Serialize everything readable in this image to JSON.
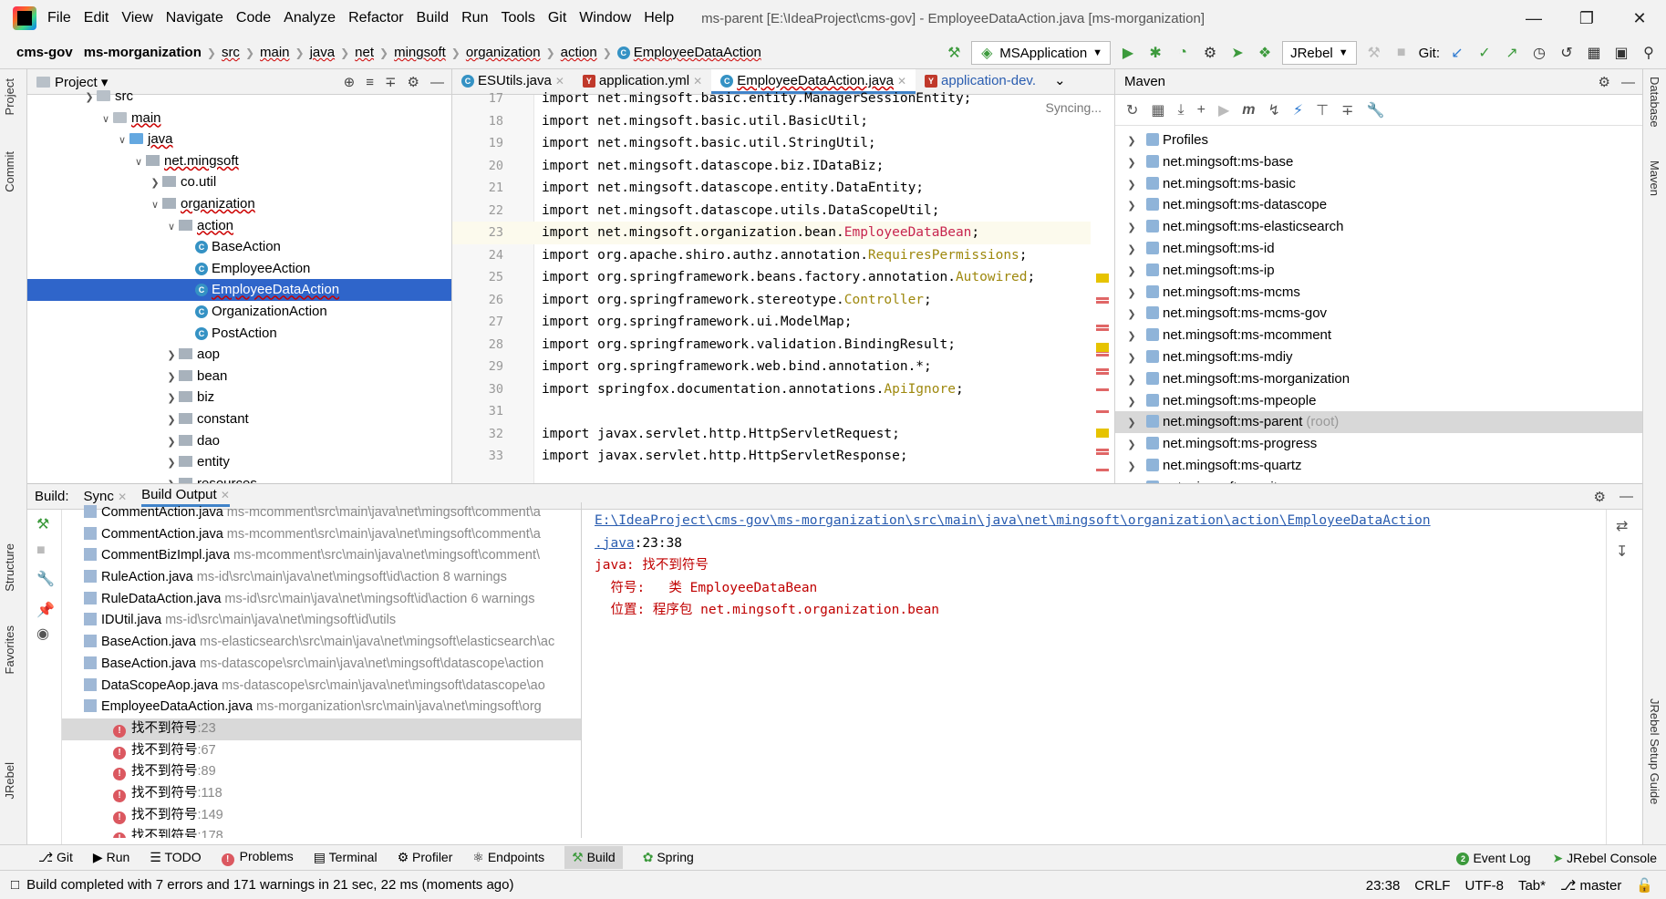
{
  "menu": {
    "items": [
      "File",
      "Edit",
      "View",
      "Navigate",
      "Code",
      "Analyze",
      "Refactor",
      "Build",
      "Run",
      "Tools",
      "Git",
      "Window",
      "Help"
    ],
    "window_title": "ms-parent [E:\\IdeaProject\\cms-gov] - EmployeeDataAction.java [ms-morganization]"
  },
  "breadcrumb": [
    "cms-gov",
    "ms-morganization",
    "src",
    "main",
    "java",
    "net",
    "mingsoft",
    "organization",
    "action",
    "EmployeeDataAction"
  ],
  "run_config": "MSApplication",
  "jrebel_config": "JRebel",
  "git_label": "Git:",
  "project": {
    "title": "Project",
    "tree": [
      {
        "label": "src",
        "indent": 0,
        "type": "folder"
      },
      {
        "label": "main",
        "indent": 1,
        "type": "folder",
        "open": true
      },
      {
        "label": "java",
        "indent": 2,
        "type": "folder-blue",
        "open": true
      },
      {
        "label": "net.mingsoft",
        "indent": 3,
        "type": "pkg",
        "open": true
      },
      {
        "label": "co.util",
        "indent": 4,
        "type": "pkg",
        "open": false
      },
      {
        "label": "organization",
        "indent": 4,
        "type": "pkg",
        "open": true
      },
      {
        "label": "action",
        "indent": 5,
        "type": "pkg",
        "open": true
      },
      {
        "label": "BaseAction",
        "indent": 6,
        "type": "class"
      },
      {
        "label": "EmployeeAction",
        "indent": 6,
        "type": "class"
      },
      {
        "label": "EmployeeDataAction",
        "indent": 6,
        "type": "class",
        "selected": true
      },
      {
        "label": "OrganizationAction",
        "indent": 6,
        "type": "class"
      },
      {
        "label": "PostAction",
        "indent": 6,
        "type": "class"
      },
      {
        "label": "aop",
        "indent": 5,
        "type": "pkg",
        "open": false
      },
      {
        "label": "bean",
        "indent": 5,
        "type": "pkg",
        "open": false
      },
      {
        "label": "biz",
        "indent": 5,
        "type": "pkg",
        "open": false
      },
      {
        "label": "constant",
        "indent": 5,
        "type": "pkg",
        "open": false
      },
      {
        "label": "dao",
        "indent": 5,
        "type": "pkg",
        "open": false
      },
      {
        "label": "entity",
        "indent": 5,
        "type": "pkg",
        "open": false
      },
      {
        "label": "resources",
        "indent": 5,
        "type": "pkg",
        "open": false
      }
    ]
  },
  "editor": {
    "tabs": [
      {
        "label": "ESUtils.java",
        "icon": "class"
      },
      {
        "label": "application.yml",
        "icon": "yml"
      },
      {
        "label": "EmployeeDataAction.java",
        "icon": "class",
        "active": true
      },
      {
        "label": "application-dev.",
        "icon": "yml"
      }
    ],
    "syncing": "Syncing...",
    "lines": [
      {
        "n": "17",
        "pre": "import net.mingsoft.basic.entity.ManagerSessionEntity;"
      },
      {
        "n": "18",
        "pre": "import net.mingsoft.basic.util.BasicUtil;"
      },
      {
        "n": "19",
        "pre": "import net.mingsoft.basic.util.StringUtil;"
      },
      {
        "n": "20",
        "pre": "import net.mingsoft.datascope.biz.IDataBiz;"
      },
      {
        "n": "21",
        "pre": "import net.mingsoft.datascope.entity.DataEntity;"
      },
      {
        "n": "22",
        "pre": "import net.mingsoft.datascope.utils.DataScopeUtil;"
      },
      {
        "n": "23",
        "pre": "import net.mingsoft.organization.bean.",
        "hl": "EmployeeDataBean",
        "post": ";",
        "style": "err",
        "current": true
      },
      {
        "n": "24",
        "pre": "import org.apache.shiro.authz.annotation.",
        "hl": "RequiresPermissions",
        "post": ";",
        "style": "ann"
      },
      {
        "n": "25",
        "pre": "import org.springframework.beans.factory.annotation.",
        "hl": "Autowired",
        "post": ";",
        "style": "ann"
      },
      {
        "n": "26",
        "pre": "import org.springframework.stereotype.",
        "hl": "Controller",
        "post": ";",
        "style": "ann"
      },
      {
        "n": "27",
        "pre": "import org.springframework.ui.ModelMap;"
      },
      {
        "n": "28",
        "pre": "import org.springframework.validation.BindingResult;"
      },
      {
        "n": "29",
        "pre": "import org.springframework.web.bind.annotation.*;"
      },
      {
        "n": "30",
        "pre": "import springfox.documentation.annotations.",
        "hl": "ApiIgnore",
        "post": ";",
        "style": "ann"
      },
      {
        "n": "31",
        "pre": ""
      },
      {
        "n": "32",
        "pre": "import javax.servlet.http.HttpServletRequest;"
      },
      {
        "n": "33",
        "pre": "import javax.servlet.http.HttpServletResponse;"
      }
    ]
  },
  "maven": {
    "title": "Maven",
    "items": [
      {
        "label": "Profiles"
      },
      {
        "label": "net.mingsoft:ms-base"
      },
      {
        "label": "net.mingsoft:ms-basic"
      },
      {
        "label": "net.mingsoft:ms-datascope"
      },
      {
        "label": "net.mingsoft:ms-elasticsearch"
      },
      {
        "label": "net.mingsoft:ms-id"
      },
      {
        "label": "net.mingsoft:ms-ip"
      },
      {
        "label": "net.mingsoft:ms-mcms"
      },
      {
        "label": "net.mingsoft:ms-mcms-gov"
      },
      {
        "label": "net.mingsoft:ms-mcomment"
      },
      {
        "label": "net.mingsoft:ms-mdiy"
      },
      {
        "label": "net.mingsoft:ms-morganization"
      },
      {
        "label": "net.mingsoft:ms-mpeople"
      },
      {
        "label": "net.mingsoft:ms-parent",
        "suffix": "(root)",
        "selected": true
      },
      {
        "label": "net.mingsoft:ms-progress"
      },
      {
        "label": "net.mingsoft:ms-quartz"
      },
      {
        "label": "net.mingsoft:ms-site"
      }
    ]
  },
  "build": {
    "label": "Build:",
    "tabs": [
      "Sync",
      "Build Output"
    ],
    "rows": [
      {
        "file": "CommentAction.java",
        "path": "ms-mcomment\\src\\main\\java\\net\\mingsoft\\comment\\a"
      },
      {
        "file": "CommentAction.java",
        "path": "ms-mcomment\\src\\main\\java\\net\\mingsoft\\comment\\a"
      },
      {
        "file": "CommentBizImpl.java",
        "path": "ms-mcomment\\src\\main\\java\\net\\mingsoft\\comment\\"
      },
      {
        "file": "RuleAction.java",
        "path": "ms-id\\src\\main\\java\\net\\mingsoft\\id\\action 8 warnings"
      },
      {
        "file": "RuleDataAction.java",
        "path": "ms-id\\src\\main\\java\\net\\mingsoft\\id\\action 6 warnings"
      },
      {
        "file": "IDUtil.java",
        "path": "ms-id\\src\\main\\java\\net\\mingsoft\\id\\utils"
      },
      {
        "file": "BaseAction.java",
        "path": "ms-elasticsearch\\src\\main\\java\\net\\mingsoft\\elasticsearch\\ac"
      },
      {
        "file": "BaseAction.java",
        "path": "ms-datascope\\src\\main\\java\\net\\mingsoft\\datascope\\action"
      },
      {
        "file": "DataScopeAop.java",
        "path": "ms-datascope\\src\\main\\java\\net\\mingsoft\\datascope\\ao"
      },
      {
        "file": "EmployeeDataAction.java",
        "path": "ms-morganization\\src\\main\\java\\net\\mingsoft\\org"
      }
    ],
    "errors": [
      {
        "msg": "找不到符号",
        "line": ":23",
        "selected": true
      },
      {
        "msg": "找不到符号",
        "line": ":67"
      },
      {
        "msg": "找不到符号",
        "line": ":89"
      },
      {
        "msg": "找不到符号",
        "line": ":118"
      },
      {
        "msg": "找不到符号",
        "line": ":149"
      },
      {
        "msg": "找不到符号",
        "line": ":178"
      }
    ],
    "output": {
      "link1": "E:\\IdeaProject\\cms-gov\\ms-morganization\\src\\main\\java\\net\\mingsoft\\organization\\action\\EmployeeDataAction",
      "link2": ".java",
      "pos": ":23:38",
      "line3": "java: 找不到符号",
      "line4": "  符号:   类 EmployeeDataBean",
      "line5": "  位置: 程序包 net.mingsoft.organization.bean"
    }
  },
  "bottom_tools": [
    "Git",
    "Run",
    "TODO",
    "Problems",
    "Terminal",
    "Profiler",
    "Endpoints",
    "Build",
    "Spring"
  ],
  "bottom_right": [
    "Event Log",
    "JRebel Console"
  ],
  "status": {
    "message": "Build completed with 7 errors and 171 warnings in 21 sec, 22 ms (moments ago)",
    "position": "23:38",
    "line_sep": "CRLF",
    "encoding": "UTF-8",
    "indent": "Tab*",
    "branch": "master"
  },
  "stripes": {
    "left": [
      "Project",
      "Commit",
      "Structure",
      "Favorites",
      "JRebel"
    ],
    "right": [
      "Database",
      "Maven",
      "JRebel Setup Guide"
    ]
  }
}
